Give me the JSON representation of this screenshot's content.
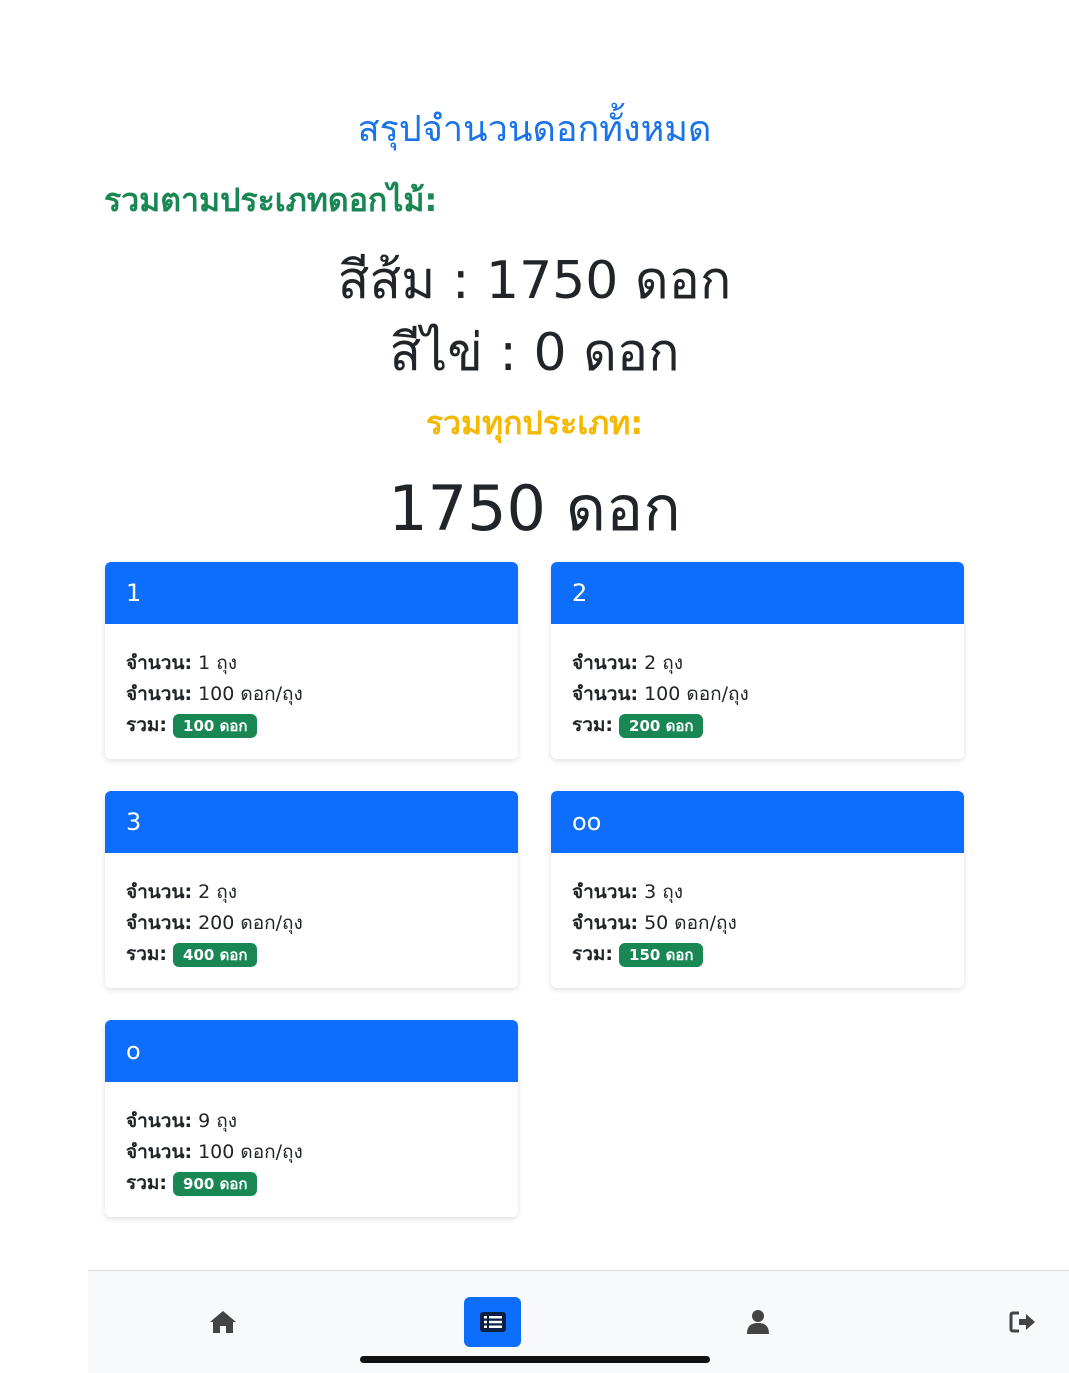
{
  "header": {
    "title": "สรุปจำนวนดอกทั้งหมด",
    "by_type_label": "รวมตามประเภทดอกไม้:",
    "types": [
      {
        "text": "สีส้ม : 1750 ดอก"
      },
      {
        "text": "สีไข่ : 0 ดอก"
      }
    ],
    "all_label": "รวมทุกประเภท:",
    "grand_total": "1750 ดอก"
  },
  "cards": [
    {
      "name": "1",
      "bags_label": "จำนวน:",
      "bags": "1 ถุง",
      "per_label": "จำนวน:",
      "per": "100 ดอก/ถุง",
      "total_label": "รวม:",
      "total": "100 ดอก"
    },
    {
      "name": "2",
      "bags_label": "จำนวน:",
      "bags": "2 ถุง",
      "per_label": "จำนวน:",
      "per": "100 ดอก/ถุง",
      "total_label": "รวม:",
      "total": "200 ดอก"
    },
    {
      "name": "3",
      "bags_label": "จำนวน:",
      "bags": "2 ถุง",
      "per_label": "จำนวน:",
      "per": "200 ดอก/ถุง",
      "total_label": "รวม:",
      "total": "400 ดอก"
    },
    {
      "name": "oo",
      "bags_label": "จำนวน:",
      "bags": "3 ถุง",
      "per_label": "จำนวน:",
      "per": "50 ดอก/ถุง",
      "total_label": "รวม:",
      "total": "150 ดอก"
    },
    {
      "name": "o",
      "bags_label": "จำนวน:",
      "bags": "9 ถุง",
      "per_label": "จำนวน:",
      "per": "100 ดอก/ถุง",
      "total_label": "รวม:",
      "total": "900 ดอก"
    }
  ],
  "nav": {
    "items": [
      {
        "icon": "home-icon",
        "active": false
      },
      {
        "icon": "list-icon",
        "active": true
      },
      {
        "icon": "user-icon",
        "active": false
      },
      {
        "icon": "logout-icon",
        "active": false
      }
    ]
  },
  "colors": {
    "primary": "#0d6efd",
    "title_blue": "#1a73e8",
    "success": "#198754",
    "warning": "#f5b800"
  }
}
